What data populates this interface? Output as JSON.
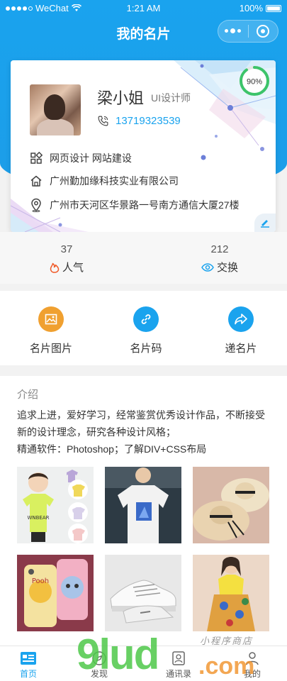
{
  "status_bar": {
    "carrier": "WeChat",
    "time": "1:21 AM",
    "battery": "100%"
  },
  "navbar": {
    "title": "我的名片"
  },
  "card": {
    "name": "梁小姐",
    "role": "UI设计师",
    "phone": "13719323539",
    "completion": "90%",
    "business": "网页设计 网站建设",
    "company": "广州勤加缘科技实业有限公司",
    "address": "广州市天河区华景路一号南方通信大厦27楼"
  },
  "stats": [
    {
      "value": "37",
      "label": "人气",
      "icon": "flame-icon"
    },
    {
      "value": "212",
      "label": "交换",
      "icon": "eye-icon"
    }
  ],
  "actions": [
    {
      "label": "名片图片",
      "icon": "image-icon",
      "color": "#f0a030"
    },
    {
      "label": "名片码",
      "icon": "link-icon",
      "color": "#1aa3ee"
    },
    {
      "label": "递名片",
      "icon": "share-icon",
      "color": "#1aa3ee"
    }
  ],
  "intro": {
    "title": "介绍",
    "line1": "追求上进，爱好学习，经常鉴赏优秀设计作品，不断接受新的设计理念，研究各种设计风格；",
    "line2": "精通软件：Photoshop；了解DIV+CSS布局"
  },
  "tabs": [
    {
      "label": "首页",
      "icon": "home-icon",
      "active": true
    },
    {
      "label": "发现",
      "icon": "discover-icon",
      "active": false
    },
    {
      "label": "通讯录",
      "icon": "contacts-icon",
      "active": false
    },
    {
      "label": "我的",
      "icon": "profile-icon",
      "active": false
    }
  ],
  "watermark": {
    "logo": "9lud",
    "domain": ".com",
    "tagline": "小程序商店"
  },
  "colors": {
    "primary": "#1aa3ee",
    "accent_orange": "#f0a030",
    "flame": "#f05a28"
  }
}
